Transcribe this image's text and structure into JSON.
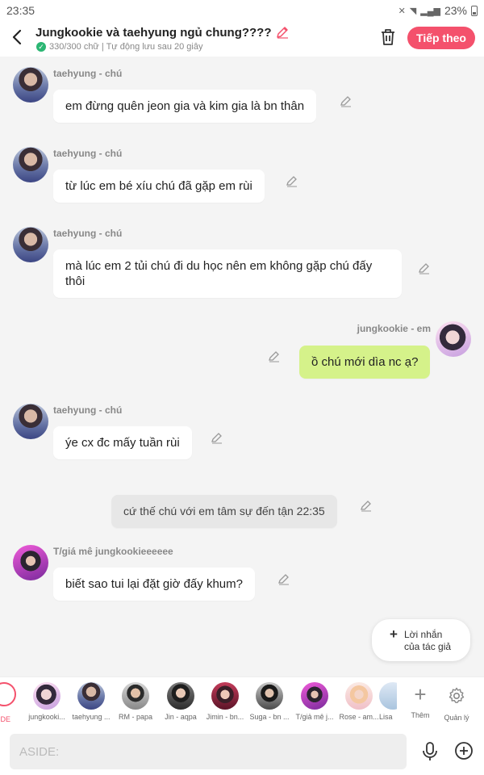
{
  "status": {
    "time": "23:35",
    "battery": "23%"
  },
  "header": {
    "title": "Jungkookie và taehyung ngủ chung????",
    "subtitle": "330/300 chữ | Tự động lưu sau 20 giây",
    "next_label": "Tiếp theo"
  },
  "messages": [
    {
      "sender": "taehyung - chú",
      "text": "em đừng quên jeon gia và kim gia là bn thân"
    },
    {
      "sender": "taehyung - chú",
      "text": "từ lúc em bé xíu chú đã gặp em rùi"
    },
    {
      "sender": "taehyung - chú",
      "text": "mà lúc em 2 tủi chú đi du học nên em không gặp chú đấy thôi"
    },
    {
      "sender": "jungkookie - em",
      "text": "ồ chú mới dìa nc ạ?"
    },
    {
      "sender": "taehyung - chú",
      "text": "ýe cx đc mấy tuần rùi"
    },
    {
      "sender": "",
      "text": "cứ thế chú với em tâm sự đến tận 22:35"
    },
    {
      "sender": "T/giá mê jungkookieeeeee",
      "text": "biết sao tui lại đặt giờ đấy khum?"
    }
  ],
  "author_note": {
    "line1": "Lời nhắn",
    "line2": "của tác giả"
  },
  "characters": {
    "aside_label": "IDE",
    "items": [
      {
        "name": "jungkooki..."
      },
      {
        "name": "taehyung ..."
      },
      {
        "name": "RM - papa"
      },
      {
        "name": "Jin - aqpa"
      },
      {
        "name": "Jimin - bn..."
      },
      {
        "name": "Suga - bn ..."
      },
      {
        "name": "T/giả mê j..."
      },
      {
        "name": "Rose - am..."
      },
      {
        "name": "Lisa"
      }
    ],
    "more_label": "Thêm",
    "manage_label": "Quản lý"
  },
  "composer": {
    "placeholder": "ASIDE:"
  },
  "colors": {
    "accent": "#f4516c",
    "mine_bubble": "#d5f28a",
    "background": "#f4f4f4"
  }
}
